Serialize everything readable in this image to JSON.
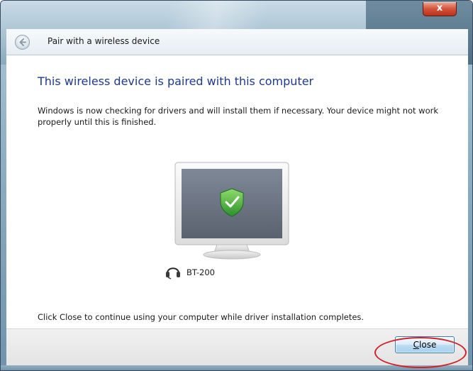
{
  "window": {
    "close_glyph": "x"
  },
  "wizard": {
    "title": "Pair with a wireless device",
    "heading": "This wireless device is paired with this computer",
    "description": "Windows is now checking for drivers and will install them if necessary. Your device might not work properly until this is finished.",
    "device_name": "BT-200",
    "footer": "Click Close to continue using your computer while driver installation completes."
  },
  "buttons": {
    "close_mnemonic": "C",
    "close_rest": "lose"
  },
  "icons": {
    "back": "back-arrow-icon",
    "monitor": "monitor-icon",
    "shield": "security-shield-check-icon",
    "headset": "headset-icon"
  },
  "colors": {
    "heading": "#1e3a8a",
    "shield_green": "#3aa63a",
    "highlight_red": "#d3202a"
  }
}
